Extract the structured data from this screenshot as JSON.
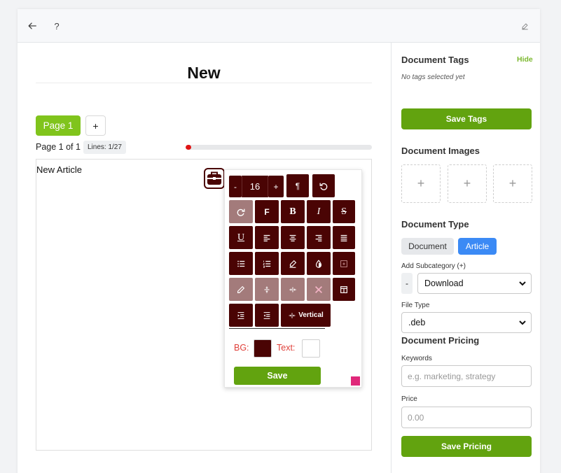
{
  "topbar": {
    "back_icon": "arrow-left-icon",
    "help_label": "?",
    "edit_icon": "edit-icon"
  },
  "document": {
    "title": "New",
    "pages": [
      {
        "label": "Page 1"
      }
    ],
    "add_page_label": "+",
    "page_info": "Page 1 of 1",
    "lines_badge": "Lines: 1/27",
    "progress_fraction": 0.03,
    "content": "New Article"
  },
  "toolbox": {
    "icon": "briefcase-icon",
    "decrease_label": "-",
    "font_size": "16",
    "increase_label": "+",
    "paragraph_label": "¶",
    "font_label": "F",
    "bold_label": "B",
    "italic_label": "I",
    "strike_label": "S",
    "underline_label": "U",
    "vertical_label": "Vertical",
    "bg_label": "BG:",
    "text_label": "Text:",
    "bg_color": "#4a0404",
    "text_color": "#ffffff",
    "save_label": "Save",
    "accent_color": "#4a0404"
  },
  "sidebar": {
    "tags": {
      "heading": "Document Tags",
      "hide_label": "Hide",
      "empty_text": "No tags selected yet",
      "save_label": "Save Tags"
    },
    "images": {
      "heading": "Document Images",
      "slots": [
        "+",
        "+",
        "+"
      ]
    },
    "type": {
      "heading": "Document Type",
      "options": [
        "Document",
        "Article"
      ],
      "selected": "Article"
    },
    "subcategory": {
      "label": "Add Subcategory (+)",
      "minus_label": "-",
      "selected": "Download"
    },
    "file_type": {
      "label": "File Type",
      "selected": ".deb"
    },
    "pricing": {
      "heading": "Document Pricing",
      "keywords_label": "Keywords",
      "keywords_placeholder": "e.g. marketing, strategy",
      "price_label": "Price",
      "price_placeholder": "0.00",
      "save_label": "Save Pricing"
    }
  }
}
